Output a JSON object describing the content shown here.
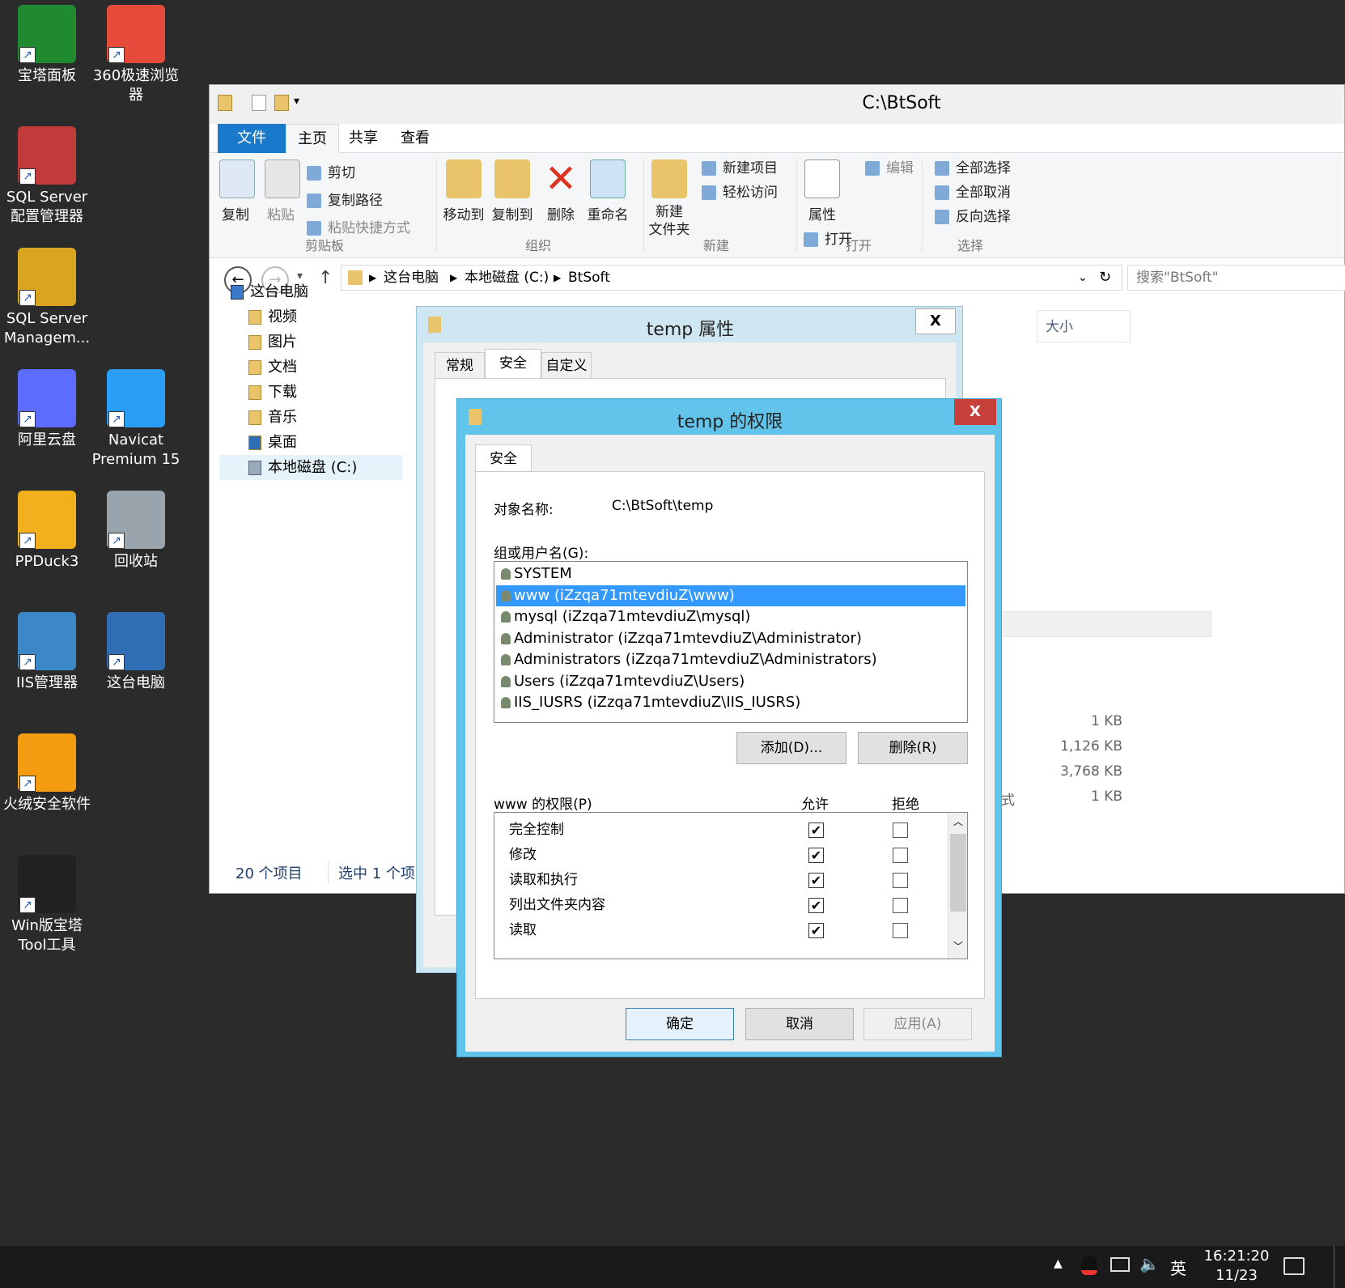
{
  "desktop": {
    "icons": [
      {
        "label": "宝塔面板",
        "icon": "bt-panel-icon",
        "color": "#1f8a2f"
      },
      {
        "label": "360极速浏览器",
        "icon": "360-browser-icon",
        "color": "#e64a3b"
      },
      {
        "label": "SQL Server 配置管理器",
        "icon": "sql-config-icon",
        "color": "#c23b3b"
      },
      {
        "label": "SQL Server Managem...",
        "icon": "sql-management-icon",
        "color": "#d9a520"
      },
      {
        "label": "阿里云盘",
        "icon": "aliyun-drive-icon",
        "color": "#5b6cff"
      },
      {
        "label": "Navicat Premium 15",
        "icon": "navicat-icon",
        "color": "#2a9df4"
      },
      {
        "label": "PPDuck3",
        "icon": "ppduck-icon",
        "color": "#f2b01e"
      },
      {
        "label": "回收站",
        "icon": "recycle-bin-icon",
        "color": "#9aa4ad"
      },
      {
        "label": "IIS管理器",
        "icon": "iis-manager-icon",
        "color": "#3c87c8"
      },
      {
        "label": "这台电脑",
        "icon": "this-pc-icon",
        "color": "#2f6db5"
      },
      {
        "label": "火绒安全软件",
        "icon": "huorong-icon",
        "color": "#f39c12"
      },
      {
        "label": "Win版宝塔 Tool工具",
        "icon": "bt-tool-icon",
        "color": "#222222"
      }
    ]
  },
  "explorer": {
    "title": "C:\\BtSoft",
    "tabs": [
      "文件",
      "主页",
      "共享",
      "查看"
    ],
    "ribbon": {
      "copy": "复制",
      "paste": "粘贴",
      "cut": "剪切",
      "copy_path": "复制路径",
      "paste_shortcut": "粘贴快捷方式",
      "group_clipboard": "剪贴板",
      "move_to": "移动到",
      "copy_to": "复制到",
      "delete": "删除",
      "rename": "重命名",
      "group_organize": "组织",
      "new_folder": "新建\n文件夹",
      "new_item": "新建项目",
      "easy_access": "轻松访问",
      "group_new": "新建",
      "properties": "属性",
      "open": "打开",
      "edit": "编辑",
      "group_open": "打开",
      "select_all": "全部选择",
      "select_none": "全部取消",
      "invert_selection": "反向选择",
      "group_select": "选择"
    },
    "breadcrumb": [
      "这台电脑",
      "本地磁盘 (C:)",
      "BtSoft"
    ],
    "search_placeholder": "搜索\"BtSoft\"",
    "nav": [
      "这台电脑",
      "视频",
      "图片",
      "文档",
      "下载",
      "音乐",
      "桌面",
      "本地磁盘 (C:)"
    ],
    "column_size": "大小",
    "sizes": [
      "1 KB",
      "1,126 KB",
      "3,768 KB",
      "1 KB"
    ],
    "partial_text": "式",
    "status_count": "20 个项目",
    "status_selected": "选中 1 个项目"
  },
  "properties_dialog": {
    "title": "temp 属性",
    "tabs": [
      "常规",
      "安全",
      "自定义"
    ]
  },
  "permissions_dialog": {
    "title": "temp 的权限",
    "tab": "安全",
    "object_label": "对象名称:",
    "object_value": "C:\\BtSoft\\temp",
    "group_label": "组或用户名(G):",
    "users": [
      "SYSTEM",
      "www (iZzqa71mtevdiuZ\\www)",
      "mysql (iZzqa71mtevdiuZ\\mysql)",
      "Administrator (iZzqa71mtevdiuZ\\Administrator)",
      "Administrators (iZzqa71mtevdiuZ\\Administrators)",
      "Users (iZzqa71mtevdiuZ\\Users)",
      "IIS_IUSRS (iZzqa71mtevdiuZ\\IIS_IUSRS)"
    ],
    "selected_user": 1,
    "add_button": "添加(D)...",
    "remove_button": "删除(R)",
    "perm_label": "www 的权限(P)",
    "allow_label": "允许",
    "deny_label": "拒绝",
    "permissions": [
      {
        "name": "完全控制",
        "allow": true,
        "deny": false
      },
      {
        "name": "修改",
        "allow": true,
        "deny": false
      },
      {
        "name": "读取和执行",
        "allow": true,
        "deny": false
      },
      {
        "name": "列出文件夹内容",
        "allow": true,
        "deny": false
      },
      {
        "name": "读取",
        "allow": true,
        "deny": false
      }
    ],
    "ok_button": "确定",
    "cancel_button": "取消",
    "apply_button": "应用(A)",
    "close": "X"
  },
  "taskbar": {
    "lang": "英",
    "time": "16:21:20",
    "date": "11/23"
  },
  "colors": {
    "accent": "#1979ca",
    "dialog_frame": "#62c4ea",
    "close_red": "#c7403a",
    "selection": "#3399ff"
  }
}
